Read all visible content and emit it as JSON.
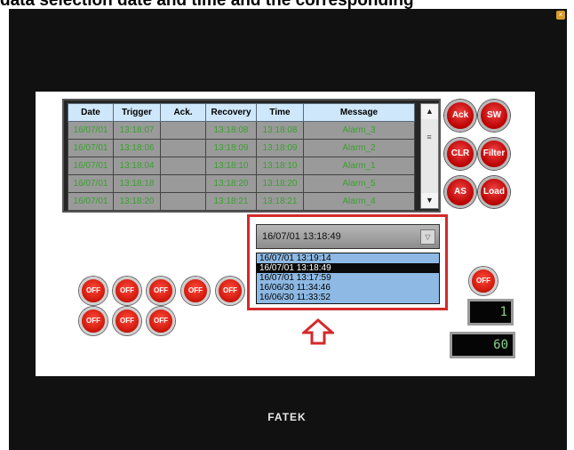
{
  "caption": "data selection date and time and the corresponding",
  "alarm_table": {
    "headers": [
      "Date",
      "Trigger",
      "Ack.",
      "Recovery",
      "Time",
      "Message"
    ],
    "rows": [
      [
        "16/07/01",
        "13:18:07",
        "",
        "13:18:08",
        "13:18:08",
        "Alarm_3"
      ],
      [
        "16/07/01",
        "13:18:06",
        "",
        "13:18:09",
        "13:18:09",
        "Alarm_2"
      ],
      [
        "16/07/01",
        "13:18:04",
        "",
        "13:18:10",
        "13:18:10",
        "Alarm_1"
      ],
      [
        "16/07/01",
        "13:18:18",
        "",
        "13:18:20",
        "13:18:20",
        "Alarm_5"
      ],
      [
        "16/07/01",
        "13:18:20",
        "",
        "13:18:21",
        "13:18:21",
        "Alarm_4"
      ]
    ],
    "scroll_up": "▲",
    "scroll_thumb": "≡",
    "scroll_down": "▼"
  },
  "side_buttons": [
    "Ack",
    "SW",
    "CLR",
    "Filter",
    "AS",
    "Load"
  ],
  "date_select": {
    "selected": "16/07/01 13:18:49",
    "arrow": "▽",
    "options": [
      "16/07/01 13:19:14",
      "16/07/01 13:18:49",
      "16/07/01 13:17:59",
      "16/06/30 11:34:46",
      "16/06/30 11:33:52"
    ],
    "selected_index": 1
  },
  "off_buttons_row1": [
    "OFF",
    "OFF",
    "OFF",
    "OFF",
    "OFF"
  ],
  "off_buttons_row2": [
    "OFF",
    "OFF",
    "OFF"
  ],
  "off_button_right": "OFF",
  "lcd_small": "1",
  "lcd_large": "60",
  "brand": "FATEK",
  "colors": {
    "frame": "#111111",
    "accent_red": "#d42a2a",
    "header_blue": "#cfe7fb",
    "list_blue": "#8eb9e4",
    "cell_green": "#3aa02f"
  }
}
